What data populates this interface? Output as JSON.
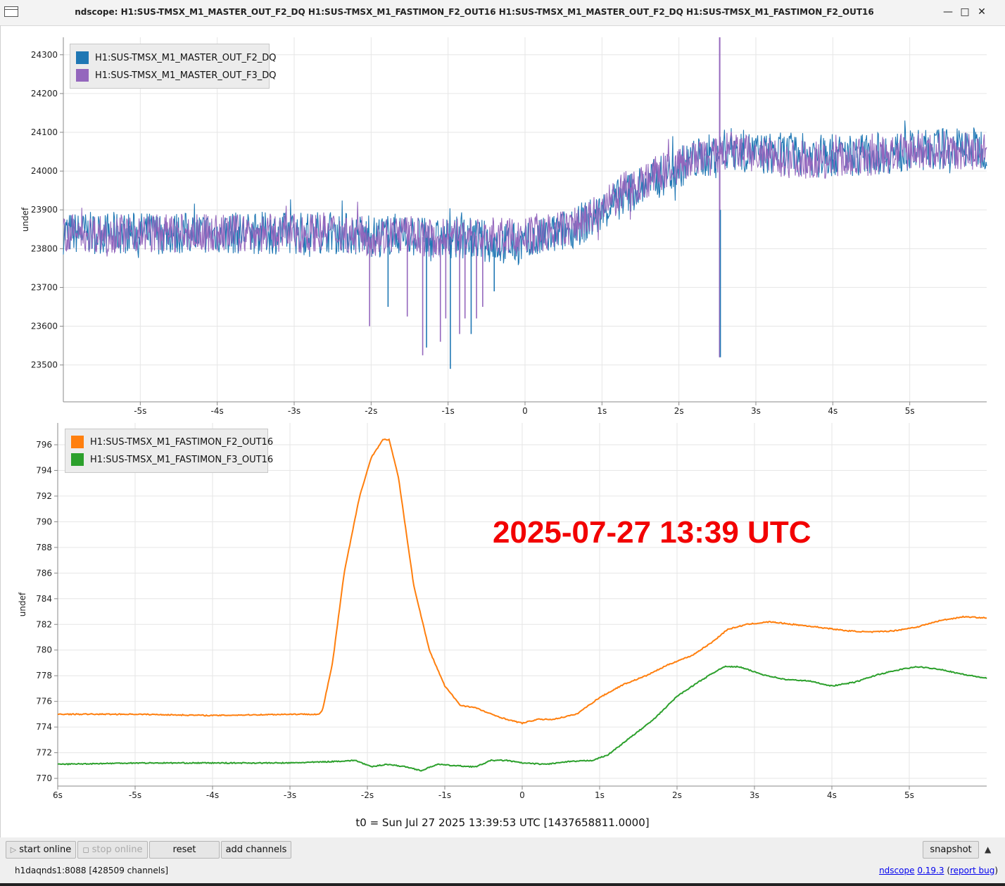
{
  "window": {
    "title": "ndscope: H1:SUS-TMSX_M1_MASTER_OUT_F2_DQ H1:SUS-TMSX_M1_FASTIMON_F2_OUT16 H1:SUS-TMSX_M1_MASTER_OUT_F2_DQ H1:SUS-TMSX_M1_FASTIMON_F2_OUT16",
    "minimize_glyph": "—",
    "maximize_glyph": "□",
    "close_glyph": "✕"
  },
  "overlay_timestamp": "2025-07-27 13:39 UTC",
  "t0_label": "t0 = Sun Jul 27 2025 13:39:53 UTC [1437658811.0000]",
  "toolbar": {
    "start_online": "start online",
    "stop_online": "stop online",
    "reset": "reset",
    "add_channels": "add channels",
    "snapshot": "snapshot",
    "collapse_glyph": "▲"
  },
  "status": {
    "server": "h1daqnds1:8088  [428509 channels]",
    "app_link": "ndscope",
    "version_link": "0.19.3",
    "report_link": "report bug"
  },
  "chart_data": [
    {
      "type": "line",
      "ylabel": "undef",
      "xlim": [
        -6,
        6
      ],
      "ylim": [
        23405,
        24345
      ],
      "x_ticks": [
        "-5s",
        "-4s",
        "-3s",
        "-2s",
        "-1s",
        "0",
        "1s",
        "2s",
        "3s",
        "4s",
        "5s"
      ],
      "x_tick_values": [
        -5,
        -4,
        -3,
        -2,
        -1,
        0,
        1,
        2,
        3,
        4,
        5
      ],
      "y_ticks": [
        23500,
        23600,
        23700,
        23800,
        23900,
        24000,
        24100,
        24200,
        24300
      ],
      "grid": true,
      "legend_position": "top-left",
      "series": [
        {
          "name": "H1:SUS-TMSX_M1_MASTER_OUT_F2_DQ",
          "color": "#1f77b4",
          "x": [
            -6,
            -5,
            -4,
            -3,
            -2.5,
            -2,
            -1.6,
            -1.2,
            -0.8,
            -0.4,
            0,
            0.5,
            0.9,
            1.3,
            1.8,
            2.2,
            2.55,
            2.65,
            3,
            3.5,
            4,
            4.5,
            5,
            5.5,
            6
          ],
          "y": [
            23840,
            23840,
            23840,
            23840,
            23845,
            23830,
            23840,
            23820,
            23830,
            23815,
            23810,
            23845,
            23880,
            23940,
            23990,
            24030,
            24050,
            24060,
            24045,
            24045,
            24040,
            24045,
            24050,
            24060,
            24060
          ],
          "band": 55
        },
        {
          "name": "H1:SUS-TMSX_M1_MASTER_OUT_F3_DQ",
          "color": "#9467bd",
          "x": [
            -6,
            -5,
            -4,
            -3,
            -2.5,
            -2,
            -1.6,
            -1.2,
            -0.8,
            -0.4,
            0,
            0.5,
            0.9,
            1.3,
            1.8,
            2.2,
            2.55,
            2.65,
            3,
            3.5,
            4,
            4.5,
            5,
            5.5,
            6
          ],
          "y": [
            23840,
            23840,
            23840,
            23840,
            23845,
            23830,
            23840,
            23825,
            23835,
            23830,
            23830,
            23850,
            23885,
            23950,
            24000,
            24030,
            24040,
            24055,
            24040,
            24030,
            24030,
            24035,
            24050,
            24055,
            24050
          ],
          "band": 50
        }
      ],
      "glitches": {
        "x": [
          -2.02,
          -1.78,
          -1.53,
          -1.33,
          -1.28,
          -1.1,
          -1.03,
          -0.97,
          -0.85,
          -0.78,
          -0.7,
          -0.63,
          -0.55,
          -0.4,
          2.53
        ],
        "y": [
          23600,
          23650,
          23625,
          23525,
          23545,
          23560,
          23620,
          23490,
          23580,
          23620,
          23580,
          23620,
          23650,
          23690,
          23520
        ]
      },
      "spike": {
        "x": 2.53,
        "top": 24345,
        "bottom": 23520
      }
    },
    {
      "type": "line",
      "ylabel": "undef",
      "xlim": [
        -6,
        6
      ],
      "ylim": [
        769.4,
        797.7
      ],
      "x_ticks": [
        "6s",
        "-5s",
        "-4s",
        "-3s",
        "-2s",
        "-1s",
        "0",
        "1s",
        "2s",
        "3s",
        "4s",
        "5s"
      ],
      "x_tick_values": [
        -6,
        -5,
        -4,
        -3,
        -2,
        -1,
        0,
        1,
        2,
        3,
        4,
        5
      ],
      "y_ticks": [
        770,
        772,
        774,
        776,
        778,
        780,
        782,
        784,
        786,
        788,
        790,
        792,
        794,
        796
      ],
      "grid": true,
      "legend_position": "top-left",
      "series": [
        {
          "name": "H1:SUS-TMSX_M1_FASTIMON_F2_OUT16",
          "color": "#ff7f0e",
          "x": [
            -6,
            -5,
            -4,
            -3,
            -2.62,
            -2.58,
            -2.45,
            -2.3,
            -2.1,
            -1.95,
            -1.8,
            -1.72,
            -1.6,
            -1.4,
            -1.2,
            -1.0,
            -0.8,
            -0.6,
            -0.4,
            -0.2,
            0,
            0.2,
            0.4,
            0.7,
            1.0,
            1.3,
            1.6,
            1.9,
            2.2,
            2.45,
            2.65,
            2.9,
            3.2,
            3.5,
            3.8,
            4.2,
            4.5,
            4.8,
            5.1,
            5.4,
            5.7,
            6.0
          ],
          "y": [
            775.0,
            775.0,
            774.9,
            775.0,
            775.0,
            775.3,
            779.0,
            786.0,
            792.0,
            795.0,
            796.4,
            796.4,
            793.5,
            785.0,
            780.0,
            777.2,
            775.7,
            775.5,
            775.0,
            774.6,
            774.3,
            774.6,
            774.6,
            775.0,
            776.3,
            777.3,
            778.0,
            778.9,
            779.6,
            780.6,
            781.6,
            782.0,
            782.2,
            782.0,
            781.8,
            781.5,
            781.4,
            781.5,
            781.8,
            782.3,
            782.6,
            782.5
          ]
        },
        {
          "name": "H1:SUS-TMSX_M1_FASTIMON_F3_OUT16",
          "color": "#2ca02c",
          "x": [
            -6,
            -5,
            -4,
            -3,
            -2.5,
            -2.15,
            -1.95,
            -1.75,
            -1.5,
            -1.3,
            -1.1,
            -0.9,
            -0.6,
            -0.4,
            -0.2,
            0,
            0.3,
            0.6,
            0.9,
            1.1,
            1.4,
            1.7,
            2.0,
            2.3,
            2.6,
            2.8,
            3.1,
            3.4,
            3.7,
            4.0,
            4.3,
            4.6,
            4.9,
            5.1,
            5.4,
            5.7,
            6.0
          ],
          "y": [
            771.1,
            771.2,
            771.2,
            771.2,
            771.3,
            771.4,
            770.9,
            771.1,
            770.9,
            770.6,
            771.1,
            771.0,
            770.9,
            771.4,
            771.4,
            771.2,
            771.1,
            771.3,
            771.4,
            771.8,
            773.2,
            774.6,
            776.4,
            777.6,
            778.7,
            778.7,
            778.1,
            777.7,
            777.6,
            777.2,
            777.5,
            778.1,
            778.5,
            778.7,
            778.5,
            778.1,
            777.8
          ]
        }
      ]
    }
  ]
}
